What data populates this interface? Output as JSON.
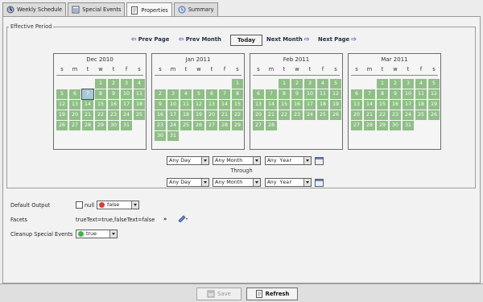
{
  "tabs": [
    {
      "label": "Weekly Schedule",
      "icon": "weekly-schedule-icon"
    },
    {
      "label": "Special Events",
      "icon": "special-events-icon"
    },
    {
      "label": "Properties",
      "icon": "properties-icon"
    },
    {
      "label": "Summary",
      "icon": "summary-icon"
    }
  ],
  "effective_period": {
    "legend": "Effective Period",
    "nav": {
      "prev_page": "Prev Page",
      "prev_month": "Prev Month",
      "today": "Today",
      "next_month": "Next Month",
      "next_page": "Next Page"
    },
    "weekdays": [
      "s",
      "m",
      "t",
      "w",
      "t",
      "f",
      "s"
    ],
    "calendars": [
      {
        "title": "Dec 2010"
      },
      {
        "title": "Jan 2011"
      },
      {
        "title": "Feb 2011"
      },
      {
        "title": "Mar 2011"
      }
    ],
    "start_selectors": {
      "day": "Any Day",
      "month": "Any Month",
      "year": "Any Year"
    },
    "through_label": "Through",
    "end_selectors": {
      "day": "Any Day",
      "month": "Any Month",
      "year": "Any Year"
    }
  },
  "properties": {
    "default_output_label": "Default Output",
    "null_label": "null",
    "default_output_value": "false",
    "facets_label": "Facets",
    "facets_value": "trueText=true,falseText=false",
    "facets_more": "»",
    "cleanup_label": "Cleanup Special Events",
    "cleanup_value": "true"
  },
  "buttons": {
    "save": "Save",
    "refresh": "Refresh"
  },
  "colors": {
    "day_cell": "#8fbf87",
    "accent": "#2b3fc4",
    "false_state": "#d63b3b",
    "true_state": "#3fb24a"
  }
}
